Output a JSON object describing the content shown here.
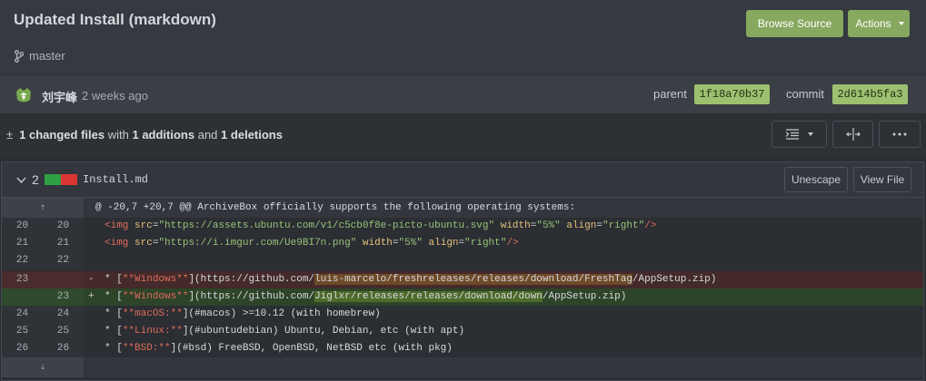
{
  "header": {
    "title": "Updated Install (markdown)",
    "branch": "master",
    "browse_source_label": "Browse Source",
    "actions_label": "Actions"
  },
  "author": {
    "name": "刘宇峰",
    "time": "2 weeks ago",
    "parent_label": "parent",
    "parent_sha": "1f18a70b37",
    "commit_label": "commit",
    "commit_sha": "2d614b5fa3"
  },
  "stats": {
    "changed_count": "1",
    "changed_label": "changed files",
    "with_label": "with",
    "additions_count": "1",
    "additions_label": "additions",
    "and_label": "and",
    "deletions_count": "1",
    "deletions_label": "deletions"
  },
  "file": {
    "change_count": "2",
    "name": "Install.md",
    "unescape_label": "Unescape",
    "view_file_label": "View File"
  },
  "diff": {
    "hunk_header": "@ -20,7 +20,7 @@ ArchiveBox officially supports the following operating systems:",
    "rows": [
      {
        "old": "20",
        "new": "20"
      },
      {
        "old": "21",
        "new": "21"
      },
      {
        "old": "22",
        "new": "22"
      },
      {
        "old": "23",
        "new": "",
        "marker": "-"
      },
      {
        "old": "",
        "new": "23",
        "marker": "+"
      },
      {
        "old": "24",
        "new": "24"
      },
      {
        "old": "25",
        "new": "25"
      },
      {
        "old": "26",
        "new": "26"
      }
    ],
    "line_20": {
      "tag_open": "<img",
      "attr1": "src",
      "val1": "\"https://assets.ubuntu.com/v1/c5cb0f8e-picto-ubuntu.svg\"",
      "attr2": "width",
      "val2": "\"5%\"",
      "attr3": "align",
      "val3": "\"right\"",
      "tag_close": "/>"
    },
    "line_21": {
      "tag_open": "<img",
      "attr1": "src",
      "val1": "\"https://i.imgur.com/Ue9BI7n.png\"",
      "attr2": "width",
      "val2": "\"5%\"",
      "attr3": "align",
      "val3": "\"right\"",
      "tag_close": "/>"
    },
    "line_del": {
      "prefix": "* [",
      "bold": "**Windows**",
      "mid": "](https://github.com/",
      "hl": "luis-marcelo/freshreleases/releases/download/FreshTag",
      "suffix": "/AppSetup.zip)"
    },
    "line_add": {
      "prefix": "* [",
      "bold": "**Windows**",
      "mid": "](https://github.com/",
      "hl1": "Jiglxr/releases/releases/download/down",
      "suffix": "/AppSetup.zip)"
    },
    "line_24": {
      "prefix": "* [",
      "bold": "**macOS:**",
      "rest": "](#macos) >=10.12 (with homebrew)"
    },
    "line_25": {
      "prefix": "* [",
      "bold": "**Linux:**",
      "rest": "](#ubuntudebian) Ubuntu, Debian, etc (with apt)"
    },
    "line_26": {
      "prefix": "* [",
      "bold": "**BSD:**",
      "rest": "](#bsd) FreeBSD, OpenBSD, NetBSD etc (with pkg)"
    }
  }
}
